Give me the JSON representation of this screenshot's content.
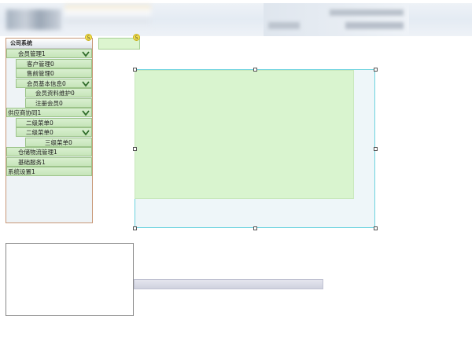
{
  "menu": {
    "title": "公司系统",
    "items": [
      {
        "label": "会员管理1",
        "expandable": true
      },
      {
        "label": "客户管理0",
        "expandable": false
      },
      {
        "label": "售前管理0",
        "expandable": false
      },
      {
        "label": "会员基本信息0",
        "expandable": true
      },
      {
        "label": "会员资料维护0",
        "expandable": false
      },
      {
        "label": "注册会员0",
        "expandable": false
      },
      {
        "label": "供应商协同1",
        "expandable": true
      },
      {
        "label": "二级菜单0",
        "expandable": false
      },
      {
        "label": "二级菜单0",
        "expandable": true
      },
      {
        "label": "三级菜单0",
        "expandable": false
      },
      {
        "label": "仓储物流管理1",
        "expandable": false
      },
      {
        "label": "基础服务1",
        "expandable": false
      },
      {
        "label": "系统设置1",
        "expandable": false
      }
    ]
  },
  "menu_badge": "5",
  "tab_badge": "5",
  "colors": {
    "menu_item_bg": "#c6e4b9",
    "canvas_border": "#6cd3df",
    "selection_fill": "#d9f4cf",
    "badge": "#f4e04a"
  }
}
